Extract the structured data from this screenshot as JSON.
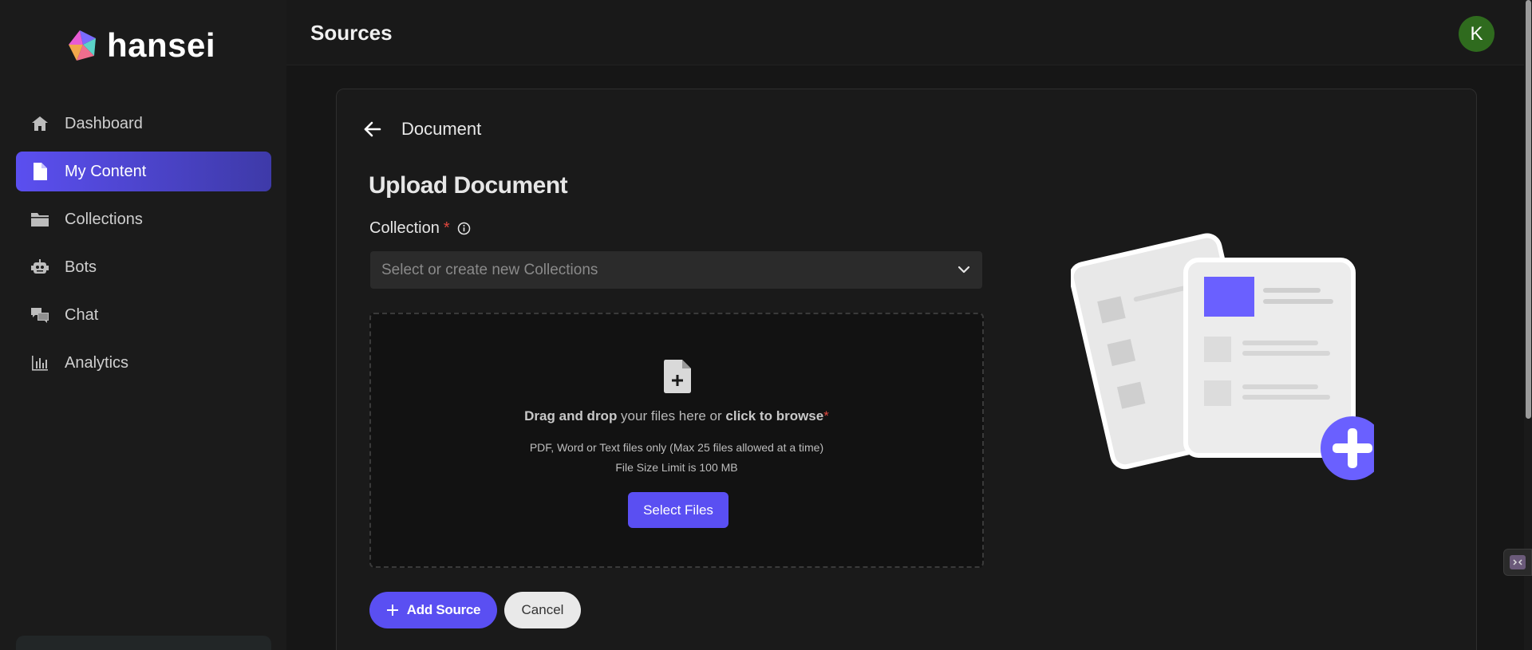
{
  "brand": {
    "name": "hansei"
  },
  "header": {
    "title": "Sources",
    "avatar_initial": "K"
  },
  "sidebar": {
    "items": [
      {
        "label": "Dashboard",
        "icon": "home-icon",
        "active": false
      },
      {
        "label": "My Content",
        "icon": "document-icon",
        "active": true
      },
      {
        "label": "Collections",
        "icon": "folder-icon",
        "active": false
      },
      {
        "label": "Bots",
        "icon": "robot-icon",
        "active": false
      },
      {
        "label": "Chat",
        "icon": "chat-icon",
        "active": false
      },
      {
        "label": "Analytics",
        "icon": "bar-chart-icon",
        "active": false
      }
    ]
  },
  "page": {
    "back_title": "Document",
    "upload_title": "Upload Document",
    "collection_label": "Collection",
    "required_mark": "*",
    "collection_placeholder": "Select or create new Collections"
  },
  "dropzone": {
    "drag_bold": "Drag and drop",
    "drag_mid": " your files here or ",
    "browse_bold": "click to browse",
    "required_mark": "*",
    "types_note": "PDF, Word or Text files only (Max 25 files allowed at a time)",
    "size_note": "File Size Limit is 100 MB",
    "select_button": "Select Files"
  },
  "actions": {
    "add_source": "Add Source",
    "cancel": "Cancel"
  },
  "colors": {
    "accent": "#5a4ff2",
    "background": "#161616",
    "sidebar": "#1b1b1b",
    "required": "#e0473e",
    "avatar": "#2f6b1e"
  }
}
